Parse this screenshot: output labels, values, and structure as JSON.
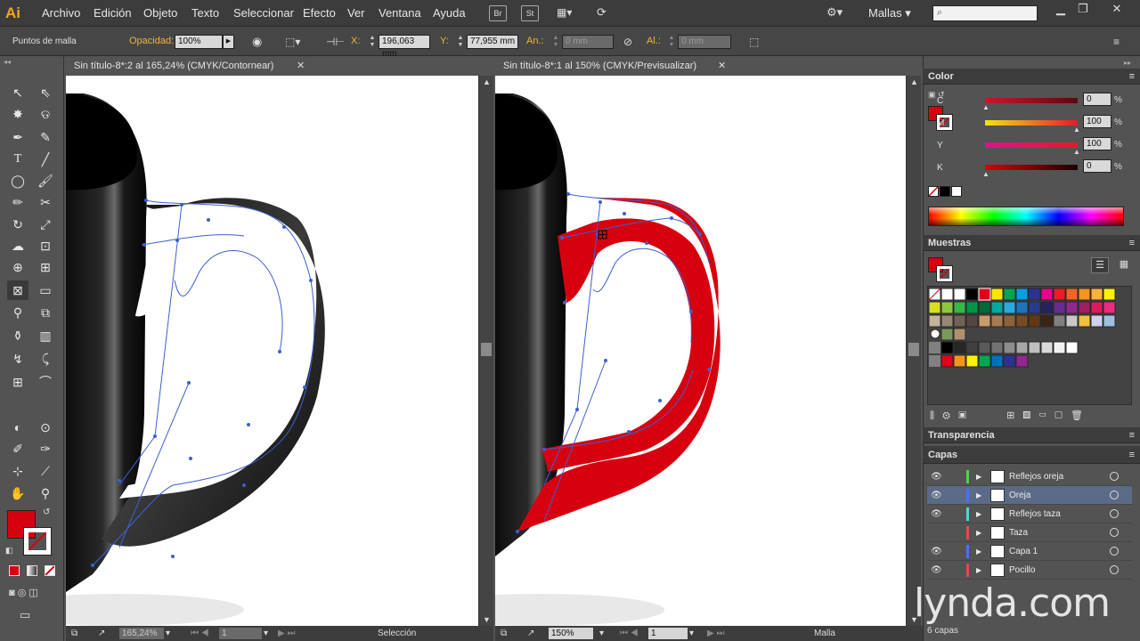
{
  "app": {
    "logo": "Ai"
  },
  "menu": [
    "Archivo",
    "Edición",
    "Objeto",
    "Texto",
    "Seleccionar",
    "Efecto",
    "Ver",
    "Ventana",
    "Ayuda"
  ],
  "menubar_buttons": [
    "Br",
    "St"
  ],
  "workspace": {
    "label": "Mallas"
  },
  "search": {
    "placeholder": ""
  },
  "control": {
    "selection_type": "Puntos de malla",
    "opacity_label": "Opacidad:",
    "opacity_value": "100%",
    "x_label": "X:",
    "x_value": "196,063 mm",
    "y_label": "Y:",
    "y_value": "77,955 mm",
    "w_label": "An.:",
    "w_value": "0 mm",
    "h_label": "Al.:",
    "h_value": "0 mm"
  },
  "tabs": [
    {
      "title": "Sin título-8*:2 al 165,24% (CMYK/Contornear)"
    },
    {
      "title": "Sin título-8*:1 al 150% (CMYK/Previsualizar)"
    }
  ],
  "status_left": {
    "zoom": "165,24%",
    "artboard": "1",
    "tool": "Selección"
  },
  "status_right": {
    "zoom": "150%",
    "artboard": "1",
    "tool": "Malla"
  },
  "color_panel": {
    "title": "Color",
    "channels": [
      {
        "label": "C",
        "value": "0"
      },
      {
        "label": "M",
        "value": "100"
      },
      {
        "label": "Y",
        "value": "100"
      },
      {
        "label": "K",
        "value": "0"
      }
    ],
    "percent": "%",
    "fill_color": "#d7000f"
  },
  "swatches_panel": {
    "title": "Muestras"
  },
  "transparency_panel": {
    "title": "Transparencia"
  },
  "layers_panel": {
    "title": "Capas",
    "count": "6 capas",
    "layers": [
      {
        "name": "Reflejos oreja",
        "color": "#4bd64b",
        "visible": true,
        "selected": false
      },
      {
        "name": "Oreja",
        "color": "#4b70ff",
        "visible": true,
        "selected": true
      },
      {
        "name": "Reflejos taza",
        "color": "#4bd6d6",
        "visible": true,
        "selected": false
      },
      {
        "name": "Taza",
        "color": "#e04b4b",
        "visible": false,
        "selected": false
      },
      {
        "name": "Capa 1",
        "color": "#4b70ff",
        "visible": true,
        "selected": false
      },
      {
        "name": "Pocillo",
        "color": "#e04b4b",
        "visible": true,
        "selected": false
      }
    ]
  },
  "watermark": "lynda.com"
}
